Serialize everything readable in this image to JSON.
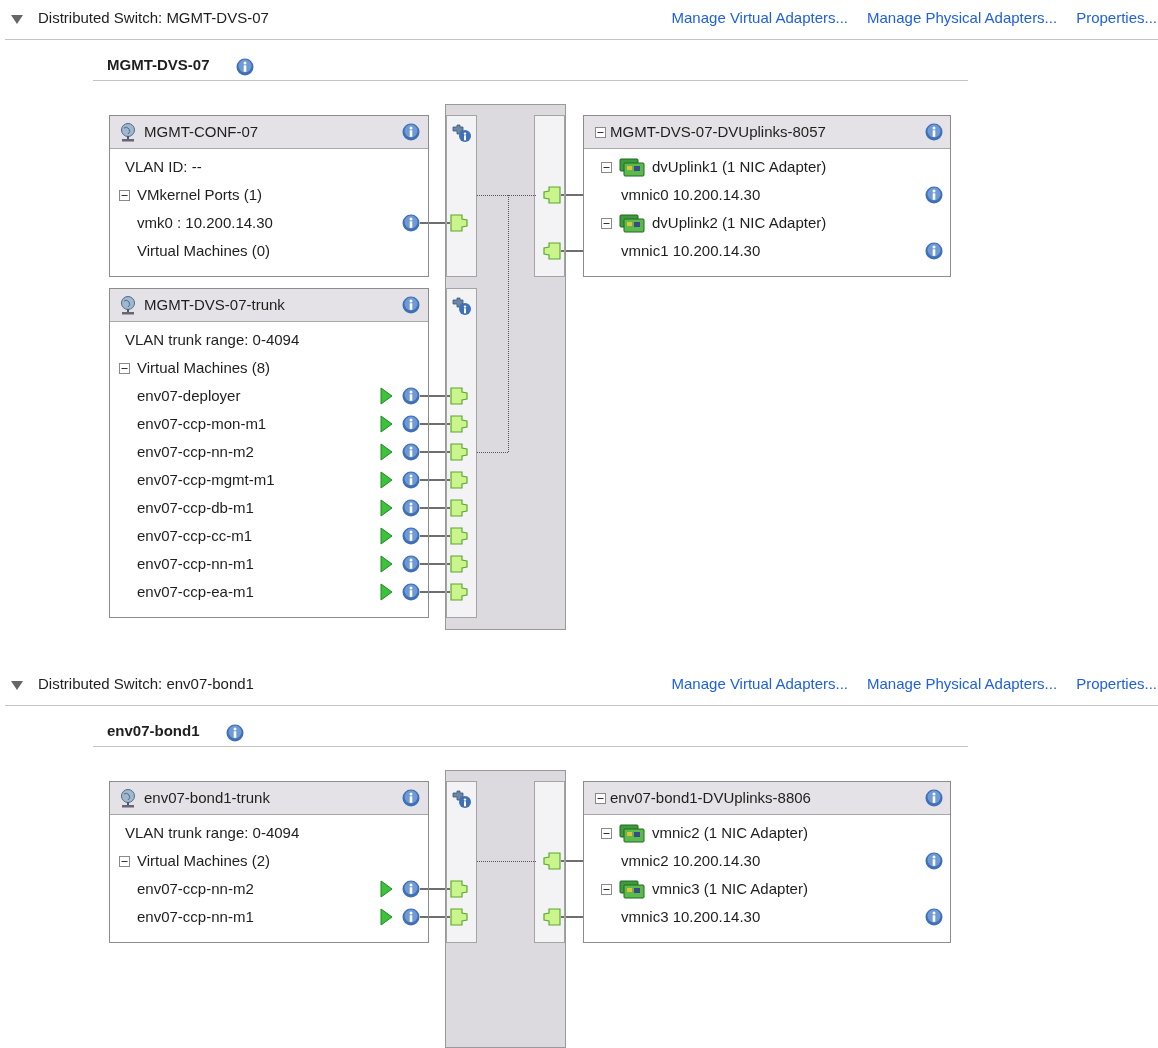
{
  "sections": [
    {
      "title": "Distributed Switch: MGMT-DVS-07",
      "expanded": true,
      "links": [
        "Manage Virtual Adapters...",
        "Manage Physical Adapters...",
        "Properties..."
      ],
      "switch_name": "MGMT-DVS-07",
      "port_groups": [
        {
          "name": "MGMT-CONF-07",
          "rows": [
            {
              "kind": "info",
              "text": "VLAN ID: --"
            },
            {
              "kind": "group",
              "text": "VMkernel Ports (1)",
              "expanded": true,
              "children": [
                {
                  "kind": "vmkernel",
                  "text": "vmk0 : 10.200.14.30"
                }
              ]
            },
            {
              "kind": "group",
              "text": "Virtual Machines (0)"
            }
          ]
        },
        {
          "name": "MGMT-DVS-07-trunk",
          "rows": [
            {
              "kind": "info",
              "text": "VLAN trunk range: 0-4094"
            },
            {
              "kind": "group",
              "text": "Virtual Machines (8)",
              "expanded": true,
              "children": [
                {
                  "kind": "vm",
                  "text": "env07-deployer",
                  "powered_on": true,
                  "traced": false
                },
                {
                  "kind": "vm",
                  "text": "env07-ccp-mon-m1",
                  "powered_on": true,
                  "traced": false
                },
                {
                  "kind": "vm",
                  "text": "env07-ccp-nn-m2",
                  "powered_on": true,
                  "traced": true
                },
                {
                  "kind": "vm",
                  "text": "env07-ccp-mgmt-m1",
                  "powered_on": true,
                  "traced": false
                },
                {
                  "kind": "vm",
                  "text": "env07-ccp-db-m1",
                  "powered_on": true,
                  "traced": false
                },
                {
                  "kind": "vm",
                  "text": "env07-ccp-cc-m1",
                  "powered_on": true,
                  "traced": false
                },
                {
                  "kind": "vm",
                  "text": "env07-ccp-nn-m1",
                  "powered_on": true,
                  "traced": false
                },
                {
                  "kind": "vm",
                  "text": "env07-ccp-ea-m1",
                  "powered_on": true,
                  "traced": false
                }
              ]
            }
          ]
        }
      ],
      "uplinks": {
        "name": "MGMT-DVS-07-DVUplinks-8057",
        "expanded": true,
        "items": [
          {
            "name": "dvUplink1 (1 NIC Adapter)",
            "expanded": true,
            "adapters": [
              "vmnic0 10.200.14.30"
            ]
          },
          {
            "name": "dvUplink2 (1 NIC Adapter)",
            "expanded": true,
            "adapters": [
              "vmnic1 10.200.14.30"
            ]
          }
        ]
      }
    },
    {
      "title": "Distributed Switch: env07-bond1",
      "expanded": true,
      "links": [
        "Manage Virtual Adapters...",
        "Manage Physical Adapters...",
        "Properties..."
      ],
      "switch_name": "env07-bond1",
      "port_groups": [
        {
          "name": "env07-bond1-trunk",
          "rows": [
            {
              "kind": "info",
              "text": "VLAN trunk range: 0-4094"
            },
            {
              "kind": "group",
              "text": "Virtual Machines (2)",
              "expanded": true,
              "children": [
                {
                  "kind": "vm",
                  "text": "env07-ccp-nn-m2",
                  "powered_on": true,
                  "traced": false
                },
                {
                  "kind": "vm",
                  "text": "env07-ccp-nn-m1",
                  "powered_on": true,
                  "traced": false
                }
              ]
            }
          ]
        }
      ],
      "uplinks": {
        "name": "env07-bond1-DVUplinks-8806",
        "expanded": true,
        "items": [
          {
            "name": "vmnic2 (1 NIC Adapter)",
            "expanded": true,
            "adapters": [
              "vmnic2 10.200.14.30"
            ]
          },
          {
            "name": "vmnic3 (1 NIC Adapter)",
            "expanded": true,
            "adapters": [
              "vmnic3 10.200.14.30"
            ]
          }
        ]
      }
    }
  ]
}
